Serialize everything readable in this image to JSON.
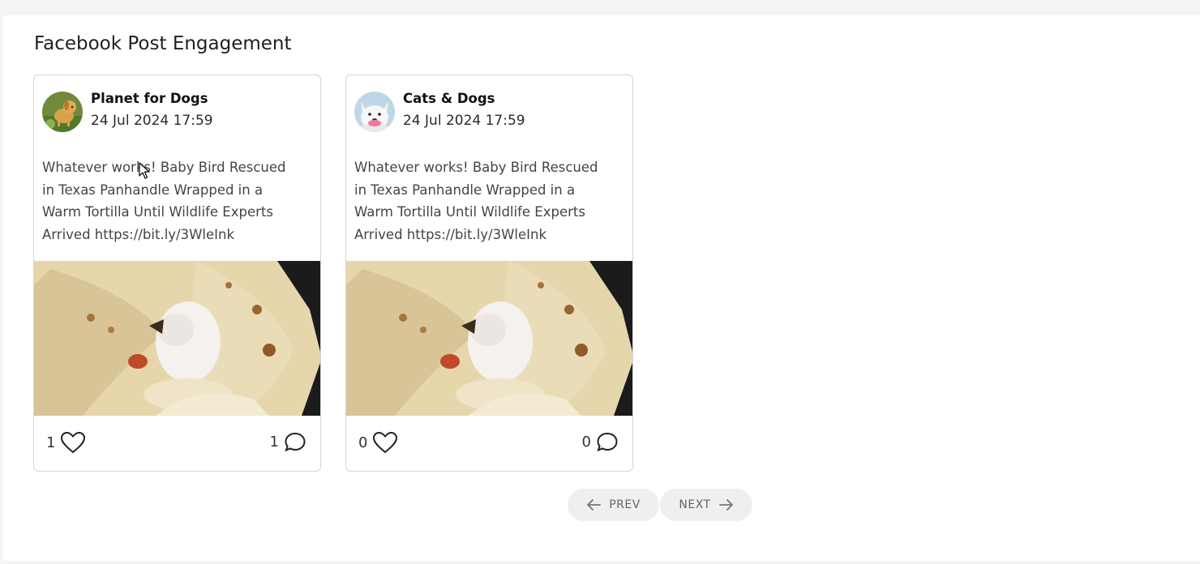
{
  "panel": {
    "title": "Facebook Post Engagement"
  },
  "posts": [
    {
      "author": "Planet for Dogs",
      "date": "24 Jul 2024 17:59",
      "text": "Whatever works! Baby Bird Rescued in Texas Panhandle Wrapped in a Warm Tortilla Until Wildlife Experts Arrived https://bit.ly/3WleInk",
      "likes": "1",
      "comments": "1",
      "avatar_icon": "dog-avatar"
    },
    {
      "author": "Cats & Dogs",
      "date": "24 Jul 2024 17:59",
      "text": "Whatever works! Baby Bird Rescued in Texas Panhandle Wrapped in a Warm Tortilla Until Wildlife Experts Arrived https://bit.ly/3WleInk",
      "likes": "0",
      "comments": "0",
      "avatar_icon": "white-dog-avatar"
    }
  ],
  "pagination": {
    "prev_label": "PREV",
    "next_label": "NEXT"
  },
  "colors": {
    "card_border": "#d4d4dc",
    "pager_bg": "#efefef",
    "panel_bg": "#ffffff",
    "page_bg": "#f4f4f4"
  }
}
